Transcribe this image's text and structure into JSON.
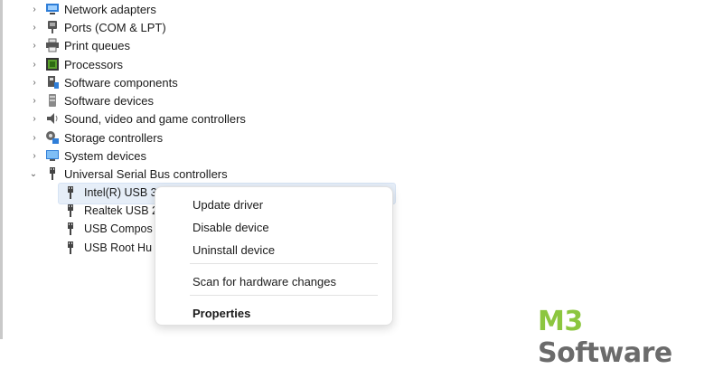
{
  "tree": {
    "categories": [
      {
        "label": "Network adapters",
        "icon": "network-adapter-icon",
        "expanded": false
      },
      {
        "label": "Ports (COM & LPT)",
        "icon": "port-icon",
        "expanded": false
      },
      {
        "label": "Print queues",
        "icon": "printer-icon",
        "expanded": false
      },
      {
        "label": "Processors",
        "icon": "processor-icon",
        "expanded": false
      },
      {
        "label": "Software components",
        "icon": "software-component-icon",
        "expanded": false
      },
      {
        "label": "Software devices",
        "icon": "software-device-icon",
        "expanded": false
      },
      {
        "label": "Sound, video and game controllers",
        "icon": "speaker-icon",
        "expanded": false
      },
      {
        "label": "Storage controllers",
        "icon": "storage-controller-icon",
        "expanded": false
      },
      {
        "label": "System devices",
        "icon": "system-device-icon",
        "expanded": false
      },
      {
        "label": "Universal Serial Bus controllers",
        "icon": "usb-icon",
        "expanded": true
      }
    ],
    "usb_children": [
      {
        "label": "Intel(R) USB 3",
        "icon": "usb-icon",
        "selected": true
      },
      {
        "label": "Realtek USB 2",
        "icon": "usb-icon",
        "selected": false
      },
      {
        "label": "USB Compos",
        "icon": "usb-icon",
        "selected": false
      },
      {
        "label": "USB Root Hu",
        "icon": "usb-icon",
        "selected": false
      }
    ]
  },
  "context_menu": {
    "items": [
      {
        "label": "Update driver"
      },
      {
        "label": "Disable device"
      },
      {
        "label": "Uninstall device"
      },
      {
        "label": "Scan for hardware changes"
      },
      {
        "label": "Properties"
      }
    ]
  },
  "watermark": {
    "brand_a": "M3",
    "brand_b": " Software"
  },
  "colors": {
    "selection": "#e6eef8",
    "brand_green": "#8cc63f",
    "brand_gray": "#6b6b6b"
  }
}
